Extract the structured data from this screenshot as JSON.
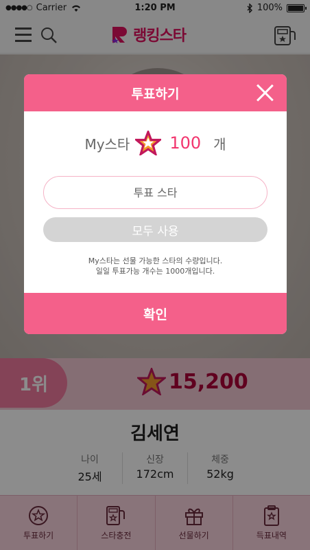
{
  "status_bar": {
    "carrier": "Carrier",
    "time": "1:20 PM",
    "battery": "100%"
  },
  "header": {
    "logo_text": "랭킹스타"
  },
  "rank": {
    "position": "1위",
    "score": "15,200"
  },
  "profile": {
    "name": "김세연",
    "stats": [
      {
        "label": "나이",
        "value": "25세"
      },
      {
        "label": "신장",
        "value": "172cm"
      },
      {
        "label": "체중",
        "value": "52kg"
      }
    ]
  },
  "tabbar": {
    "items": [
      {
        "label": "투표하기",
        "icon": "vote-star-icon"
      },
      {
        "label": "스타충전",
        "icon": "star-charge-icon"
      },
      {
        "label": "선물하기",
        "icon": "gift-icon"
      },
      {
        "label": "득표내역",
        "icon": "clipboard-star-icon"
      }
    ]
  },
  "modal": {
    "title": "투표하기",
    "my_star_label": "My스타",
    "my_star_count": "100",
    "my_star_unit": "개",
    "vote_placeholder": "투표 스타",
    "use_all_label": "모두 사용",
    "notice_line1": "My스타는 선물 가능한 스타의 수량입니다.",
    "notice_line2": "일일 투표가능 개수는 1000개입니다.",
    "confirm_label": "확인"
  },
  "colors": {
    "accent": "#f4608a",
    "star_count": "#f2356e",
    "rank_pill": "#f07a9e"
  }
}
